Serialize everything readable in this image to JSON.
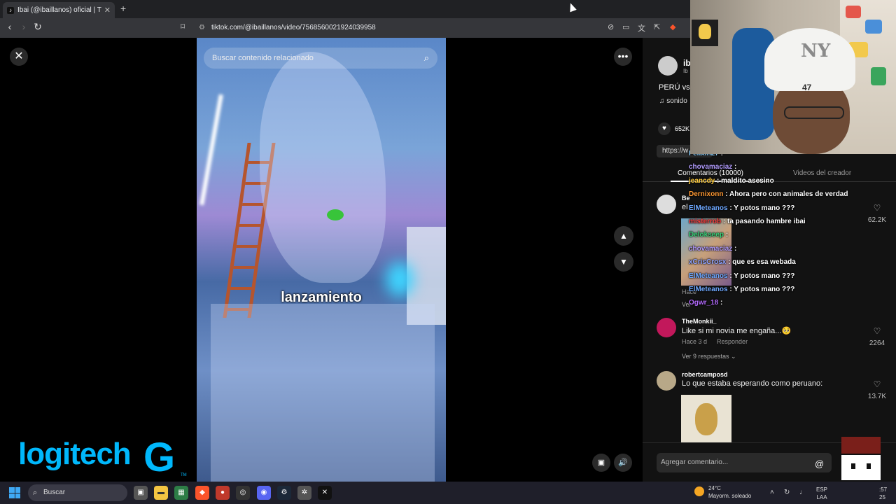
{
  "browser": {
    "tab_title": "Ibai (@ibaillanos) oficial | TikT",
    "tab_favicon": "tiktok-icon",
    "url": "tiktok.com/@ibaillanos/video/7568560021924039958"
  },
  "video": {
    "search_placeholder": "Buscar contenido relacionado",
    "caption": "lanzamiento"
  },
  "post": {
    "author": "ib",
    "author_sub": "Ib",
    "description": "PERÚ vs",
    "music": "sonido",
    "likes": "652K",
    "share_link": "https://w"
  },
  "tabs": {
    "comments": "Comentarios (10000)",
    "creator_videos": "Videos del creador"
  },
  "comments": [
    {
      "user": "Be",
      "text": "el",
      "time": "Hace",
      "reply": "",
      "likes": "62.2K",
      "replies": "Ver"
    },
    {
      "user": "TheMonkii_",
      "text": "Like si mi novia me engaña...🥺",
      "time": "Hace 3 d",
      "reply": "Responder",
      "likes": "2264",
      "replies": "Ver 9 respuestas ⌄"
    },
    {
      "user": "robertcamposd",
      "text": "Lo que estaba esperando como peruano:",
      "time": "",
      "reply": "",
      "likes": "13.7K",
      "replies": ""
    }
  ],
  "add_comment_placeholder": "Agregar comentario...",
  "chat": [
    {
      "user": "Felixin27",
      "msg": ":",
      "color": "#8fd3ff"
    },
    {
      "user": "chovamaciaz",
      "msg": ":",
      "color": "#b39dff"
    },
    {
      "user": "jeancdy",
      "msg": ": maldito asesino",
      "color": "#ffcc3d"
    },
    {
      "user": "Dernixonn",
      "msg": ": Ahora pero con animales de verdad",
      "color": "#ff9933"
    },
    {
      "user": "ElMeteanos",
      "msg": ": Y potos mano ???",
      "color": "#6ea8ff"
    },
    {
      "user": "misterrob",
      "msg": ": ta pasando hambre ibai",
      "color": "#ff3d3d"
    },
    {
      "user": "Delokseep",
      "msg": ":",
      "color": "#39d27a"
    },
    {
      "user": "chovamaciaz",
      "msg": ":",
      "color": "#b39dff"
    },
    {
      "user": "xCrisCrosx",
      "msg": ": que es esa webada",
      "color": "#8fa3ff"
    },
    {
      "user": "ElMeteanos",
      "msg": ": Y potos mano ???",
      "color": "#6ea8ff"
    },
    {
      "user": "ElMeteanos",
      "msg": ": Y potos mano ???",
      "color": "#6ea8ff"
    },
    {
      "user": "Ogwr_18",
      "msg": ":",
      "color": "#b56bff"
    }
  ],
  "overlay": {
    "brand": "logitech",
    "brand_mark": "G",
    "brand_tm": "TM",
    "cap_logo": "NY",
    "cap_badge": "47"
  },
  "taskbar": {
    "search": "Buscar",
    "weather_temp": "24°C",
    "weather_desc": "Mayorm. soleado",
    "lang_top": "ESP",
    "lang_bottom": "LAA",
    "clock_time": ":57",
    "clock_date": "25"
  }
}
